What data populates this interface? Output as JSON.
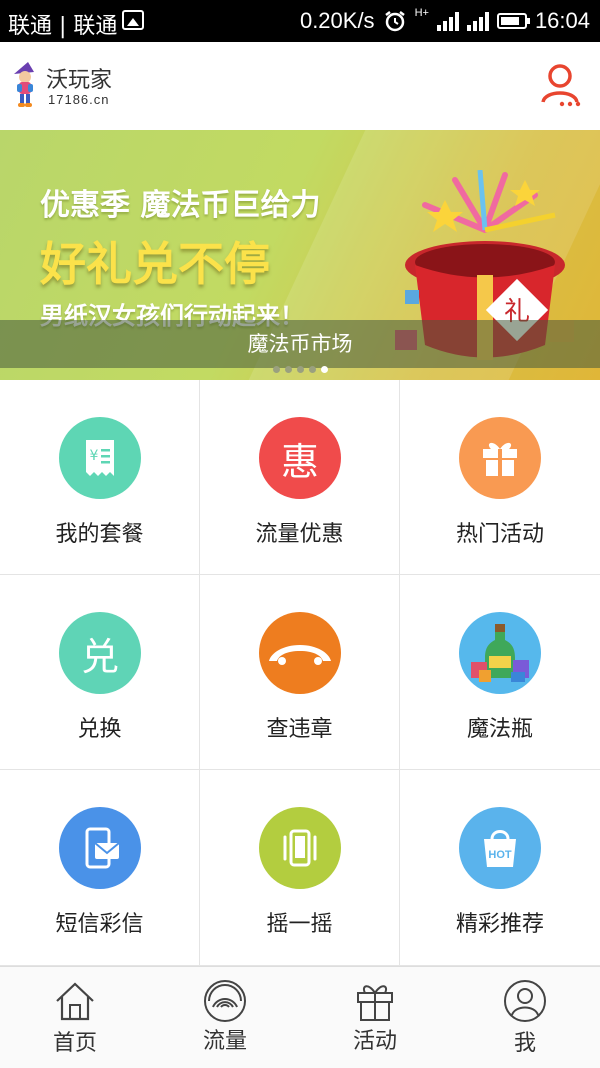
{
  "status_bar": {
    "carriers": "联通 | 联通",
    "speed": "0.20K/s",
    "network": "H+",
    "time": "16:04"
  },
  "header": {
    "app_name": "沃玩家",
    "site": "17186.cn",
    "accent_color": "#e8452f"
  },
  "banner": {
    "line1": "优惠季 魔法币巨给力",
    "line2": "好礼兑不停",
    "line3": "男纸汉女孩们行动起来！",
    "caption": "魔法币市场",
    "slide_count": 5,
    "active_slide": 5,
    "gift_char": "礼"
  },
  "grid": {
    "items": [
      {
        "label": "我的套餐",
        "icon": "bill-icon",
        "color": "#5ed6b4"
      },
      {
        "label": "流量优惠",
        "icon": "hui-icon",
        "color": "#f04b4b",
        "glyph": "惠"
      },
      {
        "label": "热门活动",
        "icon": "gift-icon",
        "color": "#f99a52"
      },
      {
        "label": "兑换",
        "icon": "dui-icon",
        "color": "#5fd4b6",
        "glyph": "兑"
      },
      {
        "label": "查违章",
        "icon": "car-icon",
        "color": "#ee7d1f"
      },
      {
        "label": "魔法瓶",
        "icon": "magic-bottle-icon",
        "color": "#56b8ec"
      },
      {
        "label": "短信彩信",
        "icon": "sms-phone-icon",
        "color": "#4a92e8"
      },
      {
        "label": "摇一摇",
        "icon": "shake-phone-icon",
        "color": "#b3cd3f"
      },
      {
        "label": "精彩推荐",
        "icon": "hot-bag-icon",
        "color": "#5ab3ec",
        "badge": "HOT"
      }
    ]
  },
  "bottom_nav": {
    "items": [
      {
        "label": "首页",
        "icon": "home-icon"
      },
      {
        "label": "流量",
        "icon": "traffic-icon"
      },
      {
        "label": "活动",
        "icon": "gift-icon"
      },
      {
        "label": "我",
        "icon": "user-icon"
      }
    ]
  }
}
